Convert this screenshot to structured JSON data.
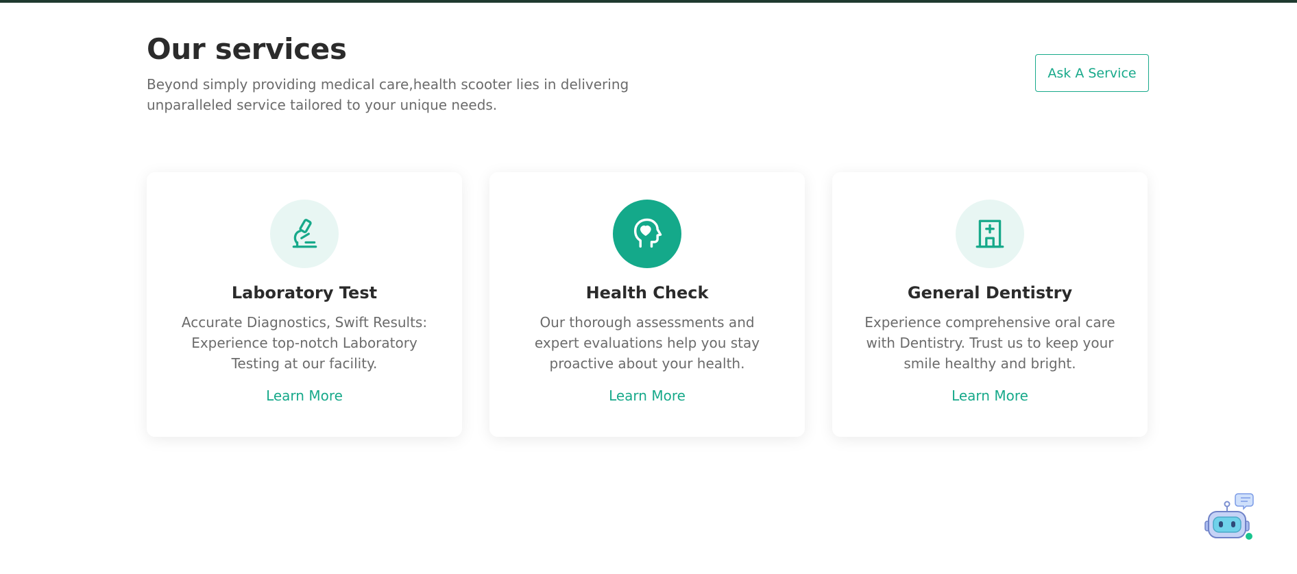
{
  "header": {
    "title": "Our services",
    "subtitle": "Beyond simply providing medical care,health scooter lies in delivering unparalleled service tailored to your unique needs.",
    "ask_button": "Ask A Service"
  },
  "services": [
    {
      "icon": "microscope-icon",
      "title": "Laboratory Test",
      "description": "Accurate Diagnostics, Swift Results: Experience top-notch Laboratory Testing at our facility.",
      "link": "Learn More"
    },
    {
      "icon": "head-heart-icon",
      "title": "Health Check",
      "description": "Our thorough assessments and expert evaluations help you stay proactive about your health.",
      "link": "Learn More"
    },
    {
      "icon": "hospital-icon",
      "title": "General Dentistry",
      "description": "Experience comprehensive oral care with Dentistry. Trust us to keep your smile healthy and bright.",
      "link": "Learn More"
    }
  ],
  "colors": {
    "accent": "#17a98a",
    "icon_bg": "#e8f6f3",
    "top_bar": "#1f3a2f"
  },
  "chatbot": {
    "icon": "chatbot-robot-icon"
  }
}
